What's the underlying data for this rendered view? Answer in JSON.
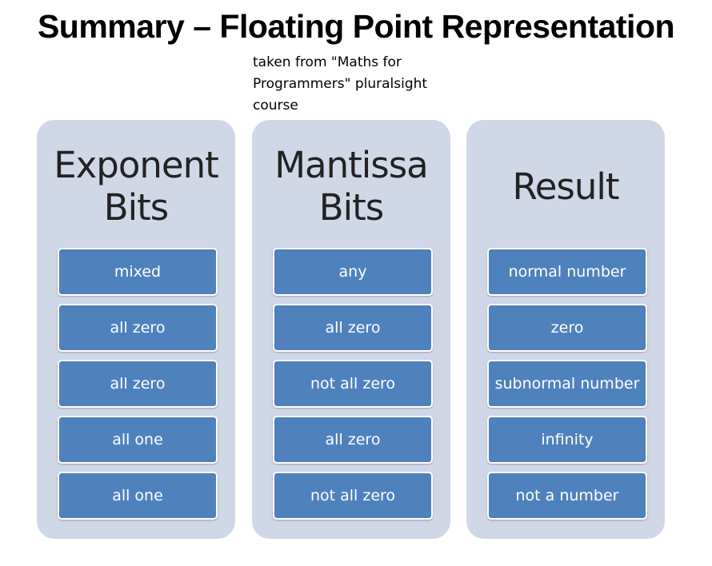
{
  "title": "Summary – Floating Point Representation",
  "note": "taken from \"Maths for Programmers\" pluralsight course",
  "columns": [
    {
      "heading": "Exponent Bits",
      "items": [
        "mixed",
        "all zero",
        "all zero",
        "all one",
        "all one"
      ]
    },
    {
      "heading": "Mantissa Bits",
      "items": [
        "any",
        "all zero",
        "not all zero",
        "all zero",
        "not all zero"
      ]
    },
    {
      "heading": "Result",
      "items": [
        "normal number",
        "zero",
        "subnormal number",
        "infinity",
        "not a number"
      ]
    }
  ],
  "colors": {
    "panel": "#d0d8e8",
    "box": "#4f81bd",
    "box_text": "#ffffff"
  }
}
